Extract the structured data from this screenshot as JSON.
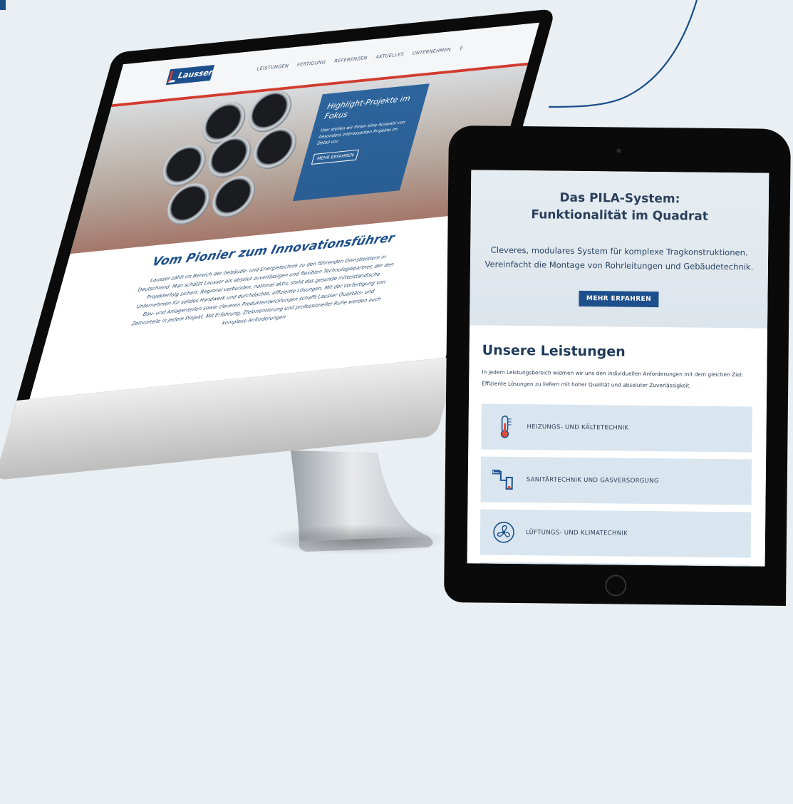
{
  "desktop_site": {
    "nav_items": [
      "LEISTUNGEN",
      "FERTIGUNG",
      "REFERENZEN",
      "AKTUELLES",
      "UNTERNEHMEN"
    ],
    "brand": "Lausser",
    "hero_panel": {
      "title": "Highlight-Projekte im Fokus",
      "text": "Hier stellen wir Ihnen eine Auswahl von besonders interessanten Projekte im Detail vor.",
      "button": "MEHR ERFAHREN"
    },
    "headline": "Vom Pionier zum Innovationsführer",
    "body_text": "Lausser zählt im Bereich der Gebäude- und Energietechnik zu den führenden Dienstleistern in Deutschland. Man schätzt Lausser als absolut zuverlässigen und flexiblen Technologiepartner, der den Projekterfolg sichert. Regional verbunden, national aktiv, steht das gesunde mittelständische Unternehmen für solides Handwerk und durchdachte, effiziente Lösungen. Mit der Vorfertigung von Bau- und Anlagenteilen sowie cleveren Produktentwicklungen schafft Lausser Qualitäts- und Zeitvorteile in jedem Projekt. Mit Erfahrung, Zielorientierung und professioneller Ruhe werden auch komplexe Anforderungen"
  },
  "tablet_site": {
    "pila": {
      "title_line1": "Das PILA-System:",
      "title_line2": "Funktionalität im Quadrat",
      "text": "Cleveres, modulares System für komplexe Tragkonstruktionen. Vereinfacht die Montage von Rohrleitungen und Gebäudetechnik.",
      "button": "MEHR ERFAHREN"
    },
    "leistungen": {
      "title": "Unsere Leistungen",
      "text": "In jedem Leistungsbereich widmen wir uns den individuellen Anforderungen mit dem gleichen Ziel: Effiziente Lösungen zu liefern mit hoher Qualität und absoluter Zuverlässigkeit.",
      "items": [
        {
          "label": "HEIZUNGS- UND KÄLTETECHNIK",
          "icon": "thermometer-icon"
        },
        {
          "label": "SANITÄRTECHNIK UND GASVERSORGUNG",
          "icon": "pipe-fitting-icon"
        },
        {
          "label": "LÜFTUNGS- UND KLIMATECHNIK",
          "icon": "fan-icon"
        }
      ]
    }
  },
  "colors": {
    "brand_blue": "#1c4f8b",
    "brand_red": "#d23b2f",
    "background": "#e9eff3"
  }
}
